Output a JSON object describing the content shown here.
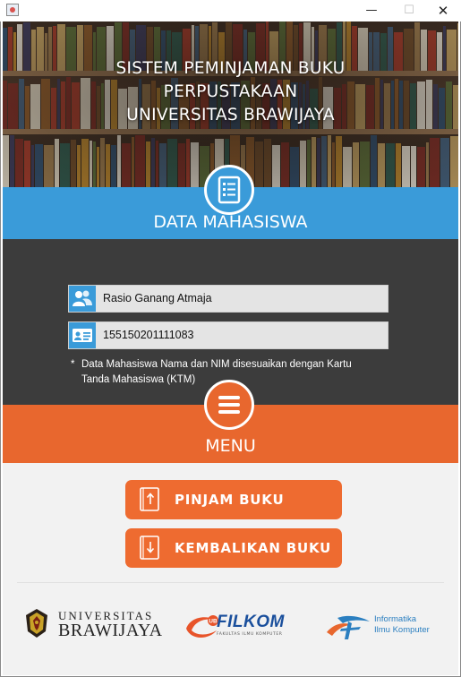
{
  "window": {
    "minimize_glyph": "—",
    "maximize_glyph": "☐",
    "close_glyph": "✕"
  },
  "header": {
    "title_lines": [
      "SISTEM PEMINJAMAN BUKU",
      "PERPUSTAKAAN",
      "UNIVERSITAS BRAWIJAYA"
    ]
  },
  "student_section": {
    "title": "DATA MAHASISWA",
    "icon": "list-document-icon",
    "name_field": {
      "value": "Rasio Ganang Atmaja",
      "icon": "users-icon"
    },
    "nim_field": {
      "value": "155150201111083",
      "icon": "id-card-icon"
    },
    "note_marker": "*",
    "note": "Data Mahasiswa Nama dan NIM disesuaikan dengan Kartu Tanda Mahasiswa (KTM)"
  },
  "menu_section": {
    "title": "MENU",
    "icon": "hamburger-menu-icon",
    "buttons": [
      {
        "label": "PINJAM BUKU",
        "icon": "book-upload-icon"
      },
      {
        "label": "KEMBALIKAN BUKU",
        "icon": "book-download-icon"
      }
    ]
  },
  "footer_logos": {
    "ub": {
      "line1": "UNIVERSITAS",
      "line2": "BRAWIJAYA"
    },
    "filkom": {
      "word": "FILKOM",
      "subtitle": "FAKULTAS ILMU KOMPUTER",
      "badge": "UB"
    },
    "informatika": {
      "line1": "Informatika",
      "line2": "Ilmu Komputer"
    }
  },
  "colors": {
    "blue": "#3a9bd9",
    "orange": "#e8672e",
    "dark": "#3c3c3c",
    "menu_bg": "#f2f2f2"
  }
}
